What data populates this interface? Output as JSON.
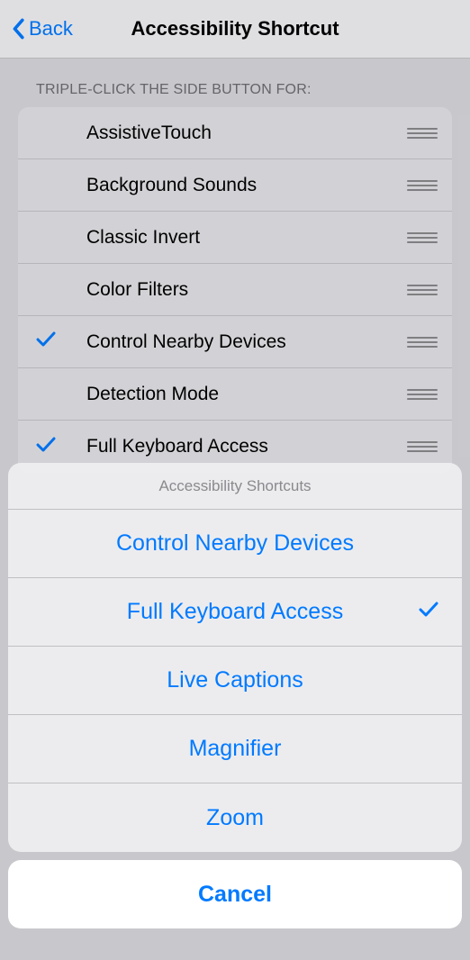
{
  "nav": {
    "back_label": "Back",
    "title": "Accessibility Shortcut"
  },
  "section_header": "TRIPLE-CLICK THE SIDE BUTTON FOR:",
  "list_items": [
    {
      "label": "AssistiveTouch",
      "selected": false
    },
    {
      "label": "Background Sounds",
      "selected": false
    },
    {
      "label": "Classic Invert",
      "selected": false
    },
    {
      "label": "Color Filters",
      "selected": false
    },
    {
      "label": "Control Nearby Devices",
      "selected": true
    },
    {
      "label": "Detection Mode",
      "selected": false
    },
    {
      "label": "Full Keyboard Access",
      "selected": true
    }
  ],
  "sheet": {
    "title": "Accessibility Shortcuts",
    "items": [
      {
        "label": "Control Nearby Devices",
        "selected": false
      },
      {
        "label": "Full Keyboard Access",
        "selected": true
      },
      {
        "label": "Live Captions",
        "selected": false
      },
      {
        "label": "Magnifier",
        "selected": false
      },
      {
        "label": "Zoom",
        "selected": false
      }
    ],
    "cancel": "Cancel"
  }
}
